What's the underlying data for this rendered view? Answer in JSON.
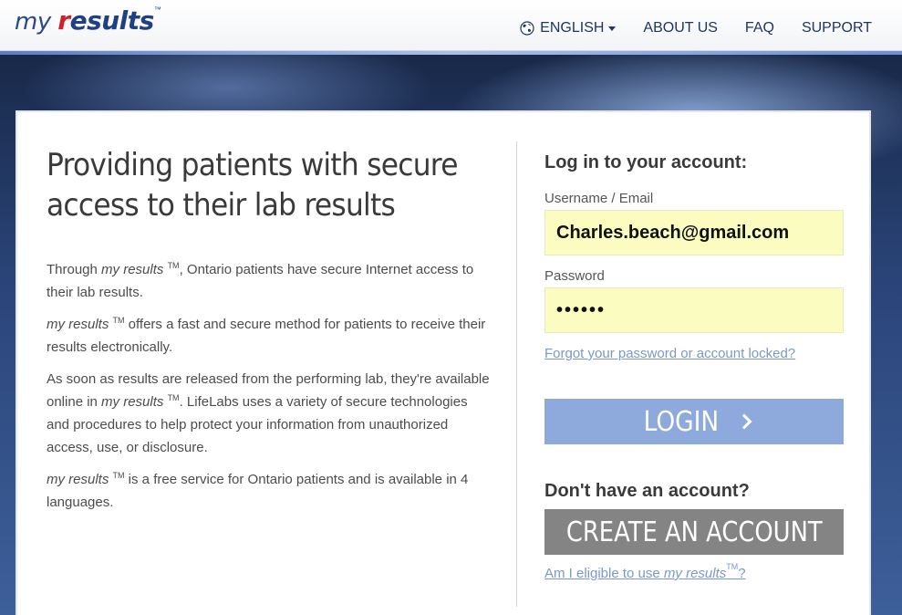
{
  "header": {
    "logo": {
      "my": "my",
      "brand_r": "r",
      "brand_rest": "esults",
      "tm": "™"
    },
    "nav": {
      "language": "ENGLISH",
      "about": "ABOUT US",
      "faq": "FAQ",
      "support": "SUPPORT"
    }
  },
  "intro": {
    "headline": "Providing patients with secure access to their lab results",
    "tm": "TM",
    "brand": "my results",
    "p1_pre": "Through ",
    "p1_post": ", Ontario patients have secure Internet access to their lab results.",
    "p2_post": " offers a fast and secure method for patients to receive their results electronically.",
    "p3_pre": "As soon as results are released from the performing lab, they're available online in ",
    "p3_post": ". LifeLabs uses a variety of secure technologies and procedures to help protect your information from unauthorized access, use, or disclosure.",
    "p4_post": " is a free service for Ontario patients and is available in 4 languages."
  },
  "login": {
    "title": "Log in to your account:",
    "username_label": "Username / Email",
    "username_value": "Charles.beach@gmail.com",
    "password_label": "Password",
    "password_value": "••••••",
    "forgot_link": "Forgot your password or account locked?",
    "login_button": "LOGIN",
    "no_account": "Don't have an account?",
    "create_button": "CREATE AN ACCOUNT",
    "eligible_pre": "Am I eligible to use ",
    "eligible_brand": "my results",
    "eligible_tm": "TM",
    "eligible_post": "?"
  },
  "colors": {
    "brand_blue": "#1f3f86",
    "brand_red": "#d31f2a",
    "input_bg": "#fbfdc0",
    "login_button": "#8ea9dc",
    "create_button": "#848484",
    "link": "#7a98c9"
  }
}
